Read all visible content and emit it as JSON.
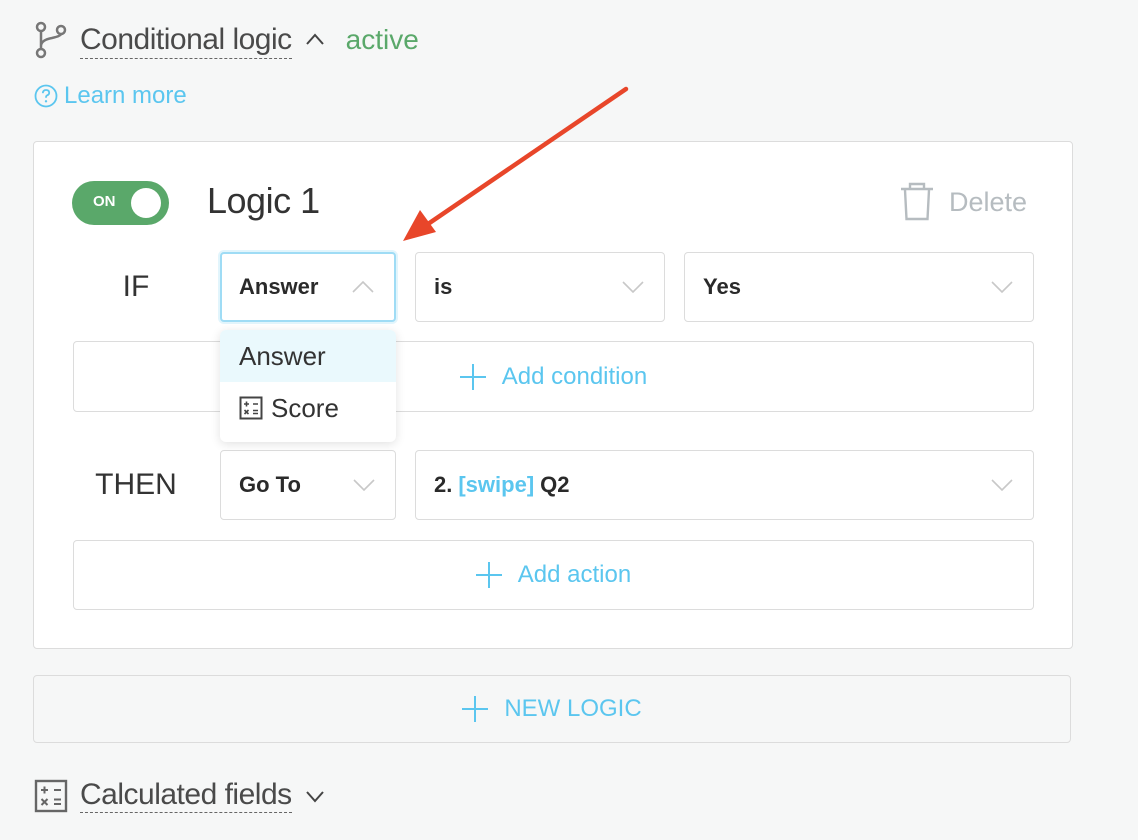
{
  "section": {
    "title": "Conditional logic",
    "status": "active",
    "learn_more": "Learn more"
  },
  "logic": {
    "toggle_label": "ON",
    "toggle_on": true,
    "name": "Logic 1",
    "delete_label": "Delete",
    "if_label": "IF",
    "then_label": "THEN",
    "condition": {
      "subject": "Answer",
      "operator": "is",
      "value": "Yes"
    },
    "subject_menu": [
      {
        "label": "Answer",
        "icon": null,
        "highlighted": true
      },
      {
        "label": "Score",
        "icon": "calculator-icon",
        "highlighted": false
      }
    ],
    "add_condition_label": "Add condition",
    "action": {
      "type": "Go To",
      "target_prefix": "2.",
      "target_tag": "[swipe]",
      "target_name": "Q2"
    },
    "add_action_label": "Add action"
  },
  "new_logic_label": "NEW LOGIC",
  "calculated_fields": {
    "title": "Calculated fields"
  },
  "colors": {
    "accent": "#5bc6ef",
    "active": "#5aa86a",
    "annotation_arrow": "#e8462a"
  }
}
